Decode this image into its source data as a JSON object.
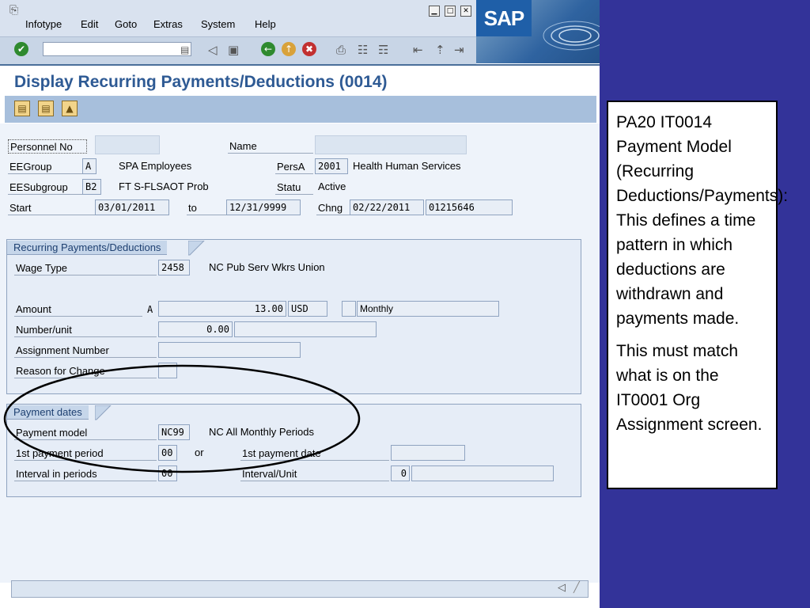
{
  "menubar": {
    "items": [
      "Infotype",
      "Edit",
      "Goto",
      "Extras",
      "System",
      "Help"
    ],
    "logo_text": "SAP"
  },
  "toolbar": {
    "command_field_value": ""
  },
  "page_title": "Display Recurring Payments/Deductions (0014)",
  "header": {
    "personnel_no_label": "Personnel No",
    "personnel_no_value": "",
    "name_label": "Name",
    "name_value": "",
    "eegroup_label": "EEGroup",
    "eegroup_value": "A",
    "eegroup_text": "SPA Employees",
    "persa_label": "PersA",
    "persa_value": "2001",
    "persa_text": "Health Human Services",
    "eesubgroup_label": "EESubgroup",
    "eesubgroup_value": "B2",
    "eesubgroup_text": "FT S-FLSAOT Prob",
    "statu_label": "Statu",
    "statu_value": "Active",
    "start_label": "Start",
    "start_value": "03/01/2011",
    "to_label": "to",
    "to_value": "12/31/9999",
    "chng_label": "Chng",
    "chng_date": "02/22/2011",
    "chng_user": "01215646"
  },
  "recurring": {
    "tab_label": "Recurring Payments/Deductions",
    "wage_type_label": "Wage Type",
    "wage_type_value": "2458",
    "wage_type_text": "NC Pub Serv Wkrs Union",
    "amount_label": "Amount",
    "amount_indicator": "A",
    "amount_value": "13.00",
    "currency_value": "USD",
    "frequency_value": "Monthly",
    "number_unit_label": "Number/unit",
    "number_unit_value": "0.00",
    "assignment_number_label": "Assignment Number",
    "reason_label": "Reason for Change"
  },
  "payment_dates": {
    "tab_label": "Payment dates",
    "payment_model_label": "Payment model",
    "payment_model_value": "NC99",
    "payment_model_text": "NC All Monthly Periods",
    "first_period_label": "1st payment period",
    "first_period_value": "00",
    "or_text": "or",
    "first_date_label": "1st payment date",
    "interval_periods_label": "Interval in periods",
    "interval_periods_value": "00",
    "interval_unit_label": "Interval/Unit",
    "interval_unit_value": "0"
  },
  "note": {
    "paragraph1": "PA20 IT0014 Payment Model (Recurring Deductions/Payments):  This defines a time pattern in which deductions are withdrawn and payments made.",
    "paragraph2": "This must match what is on the IT0001 Org Assignment screen."
  },
  "colors": {
    "background": "#333399",
    "title": "#2e5a94",
    "annotation_ellipse": "#000000"
  }
}
